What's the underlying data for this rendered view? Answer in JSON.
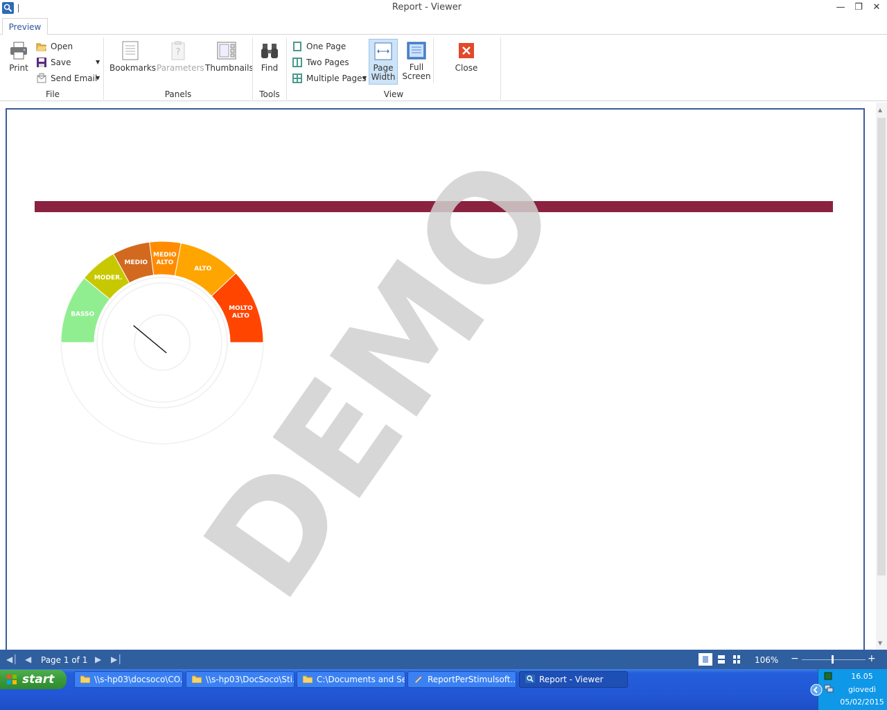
{
  "window": {
    "title": "Report - Viewer"
  },
  "ribbon": {
    "tab": "Preview",
    "file": {
      "label": "File",
      "print": "Print",
      "open": "Open",
      "save": "Save",
      "send_email": "Send Email"
    },
    "panels": {
      "label": "Panels",
      "bookmarks": "Bookmarks",
      "parameters": "Parameters",
      "thumbnails": "Thumbnails"
    },
    "tools": {
      "label": "Tools",
      "find": "Find"
    },
    "view": {
      "label": "View",
      "one_page": "One Page",
      "two_pages": "Two Pages",
      "multiple_pages": "Multiple Pages",
      "page_width_1": "Page",
      "page_width_2": "Width",
      "full_screen_1": "Full",
      "full_screen_2": "Screen",
      "close": "Close"
    }
  },
  "report": {
    "banner_color": "#8b2240",
    "watermark": "DEMO",
    "gauge": {
      "segments": [
        {
          "label": "BASSO",
          "color": "#90ee90",
          "from": 0,
          "to": 22
        },
        {
          "label": "MODER.",
          "color": "#c8c800",
          "from": 22,
          "to": 34
        },
        {
          "label": "MEDIO",
          "color": "#d2691e",
          "from": 34,
          "to": 46
        },
        {
          "label": "MEDIO ALTO",
          "color": "#ff8c00",
          "from": 46,
          "to": 56
        },
        {
          "label": "ALTO",
          "color": "#ffa500",
          "from": 56,
          "to": 76
        },
        {
          "label": "MOLTO ALTO",
          "color": "#ff4500",
          "from": 76,
          "to": 100
        }
      ],
      "needle_value": 17
    }
  },
  "statusbar": {
    "page": "Page 1 of 1",
    "zoom": "106%"
  },
  "taskbar": {
    "start": "start",
    "tasks": [
      "\\\\s-hp03\\docsoco\\CO...",
      "\\\\s-hp03\\DocSoco\\Sti...",
      "C:\\Documents and Se...",
      "ReportPerStimulsoft....",
      "Report - Viewer"
    ],
    "clock": {
      "time": "16.05",
      "day": "giovedì",
      "date": "05/02/2015"
    }
  }
}
